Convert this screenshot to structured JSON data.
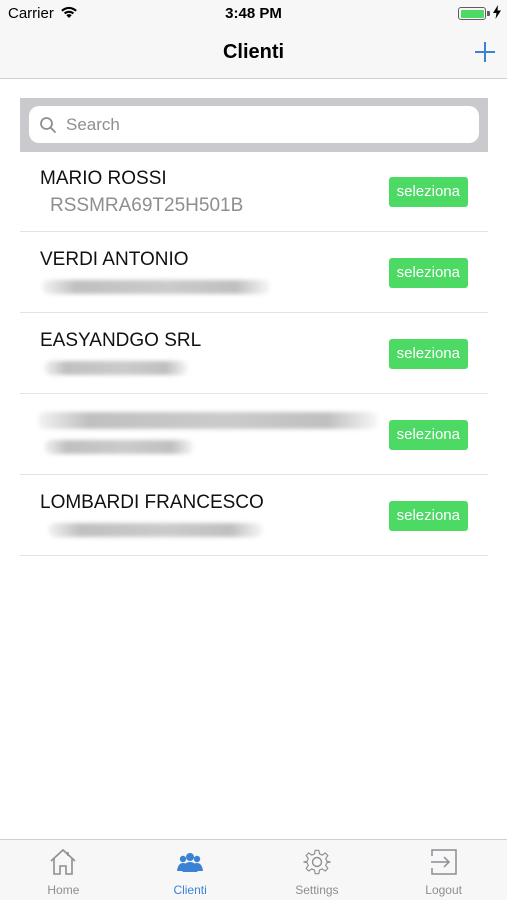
{
  "status_bar": {
    "carrier": "Carrier",
    "time": "3:48 PM"
  },
  "nav": {
    "title": "Clienti",
    "add_icon": "plus-icon"
  },
  "search": {
    "placeholder": "Search",
    "value": ""
  },
  "clients": [
    {
      "name": "MARIO ROSSI",
      "code": "RSSMRA69T25H501B",
      "action": "seleziona"
    },
    {
      "name": "VERDI ANTONIO",
      "code": "",
      "action": "seleziona"
    },
    {
      "name": "EASYANDGO SRL",
      "code": "",
      "action": "seleziona"
    },
    {
      "name": "",
      "code": "",
      "action": "seleziona"
    },
    {
      "name": "LOMBARDI FRANCESCO",
      "code": "",
      "action": "seleziona"
    }
  ],
  "tabs": [
    {
      "label": "Home",
      "icon": "home-icon",
      "active": false
    },
    {
      "label": "Clienti",
      "icon": "users-icon",
      "active": true
    },
    {
      "label": "Settings",
      "icon": "gear-icon",
      "active": false
    },
    {
      "label": "Logout",
      "icon": "logout-icon",
      "active": false
    }
  ],
  "colors": {
    "accent": "#3b82d6",
    "select_button": "#4cd964",
    "bar_background": "#f7f7f7"
  }
}
